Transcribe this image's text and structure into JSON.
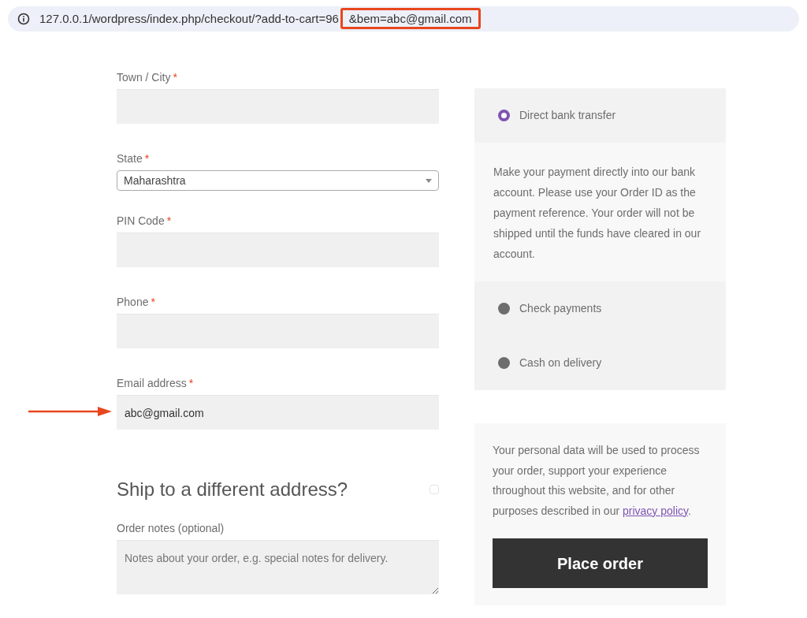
{
  "address_bar": {
    "url": "127.0.0.1/wordpress/index.php/checkout/?add-to-cart=96",
    "highlighted_part": "&bem=abc@gmail.com"
  },
  "billing_fields": [
    {
      "kind": "text",
      "label": "Town / City",
      "required_mark": "*",
      "pointed_at": false
    },
    {
      "kind": "select",
      "label": "State",
      "required_mark": "*",
      "value": "Maharashtra",
      "pointed_at": false
    },
    {
      "kind": "text",
      "label": "PIN Code",
      "required_mark": "*",
      "pointed_at": false
    },
    {
      "kind": "text",
      "label": "Phone",
      "required_mark": "*",
      "pointed_at": false
    },
    {
      "kind": "text",
      "label": "Email address",
      "required_mark": "*",
      "value": "abc@gmail.com",
      "pointed_at": true
    }
  ],
  "ship_different": {
    "title": "Ship to a different address?",
    "checked": false
  },
  "order_notes": {
    "label": "Order notes (optional)",
    "placeholder": "Notes about your order, e.g. special notes for delivery."
  },
  "payment_methods": [
    {
      "label": "Direct bank transfer",
      "selected": true,
      "description": "Make your payment directly into our bank account. Please use your Order ID as the payment reference. Your order will not be shipped until the funds have cleared in our account."
    },
    {
      "label": "Check payments",
      "selected": false
    },
    {
      "label": "Cash on delivery",
      "selected": false
    }
  ],
  "privacy": {
    "text_before": "Your personal data will be used to process your order, support your experience throughout this website, and for other purposes described in our ",
    "link": "privacy policy",
    "text_after": "."
  },
  "place_order_button": "Place order"
}
